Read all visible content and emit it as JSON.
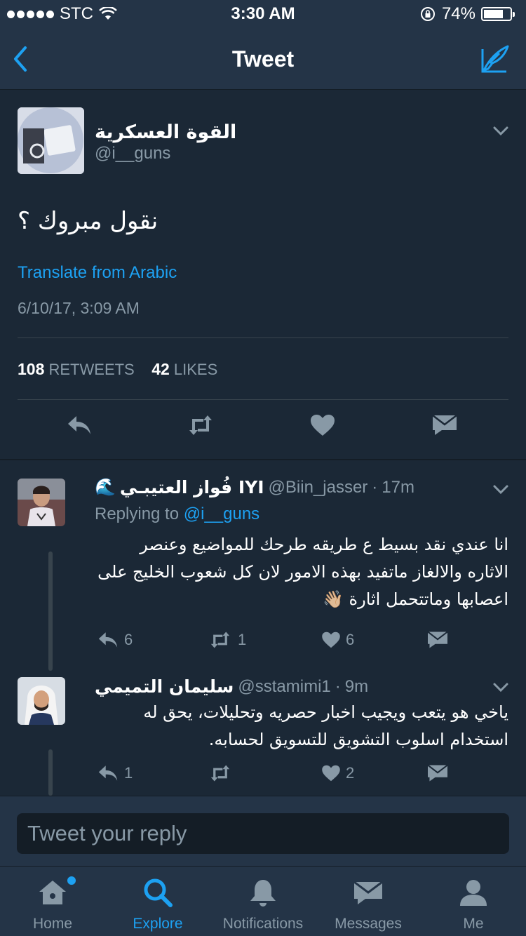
{
  "status": {
    "carrier": "STC",
    "time": "3:30 AM",
    "battery": "74%",
    "battery_level": 0.74
  },
  "nav": {
    "title": "Tweet"
  },
  "tweet": {
    "display_name": "القوة العسكرية",
    "handle": "@i__guns",
    "text": "نقول مبروك ؟",
    "translate": "Translate from Arabic",
    "timestamp": "6/10/17, 3:09 AM",
    "retweets_count": "108",
    "retweets_label": "RETWEETS",
    "likes_count": "42",
    "likes_label": "LIKES"
  },
  "replies": [
    {
      "display_name": "فُواز العتيبـي IYI",
      "wave_icon": "🌊",
      "handle": "@Biin_jasser",
      "separator": "·",
      "age": "17m",
      "replying_prefix": "Replying to",
      "replying_to": "@i__guns",
      "text": "انا عندي نقد بسيط ع طريقه طرحك للمواضيع وعنصر الاثاره والالغاز ماتفيد بهذه الامور لان كل شعوب الخليج على اعصابها وماتتحمل اثارة 👋🏼",
      "reply_count": "6",
      "retweet_count": "1",
      "like_count": "6"
    },
    {
      "display_name": "سليمان التميمي",
      "handle": "@sstamimi1",
      "separator": "·",
      "age": "9m",
      "text": "ياخي هو يتعب ويجيب اخبار حصريه وتحليلات، يحق له استخدام اسلوب التشويق للتسويق لحسابه.",
      "reply_count": "1",
      "retweet_count": "",
      "like_count": "2"
    }
  ],
  "reply_box": {
    "placeholder": "Tweet your reply"
  },
  "tabs": [
    {
      "label": "Home",
      "icon": "home-icon"
    },
    {
      "label": "Explore",
      "icon": "search-icon"
    },
    {
      "label": "Notifications",
      "icon": "bell-icon"
    },
    {
      "label": "Messages",
      "icon": "envelope-icon"
    },
    {
      "label": "Me",
      "icon": "person-icon"
    }
  ],
  "colors": {
    "accent": "#1da1f2",
    "background": "#1b2836",
    "bar": "#243447",
    "muted": "#8899a6"
  }
}
